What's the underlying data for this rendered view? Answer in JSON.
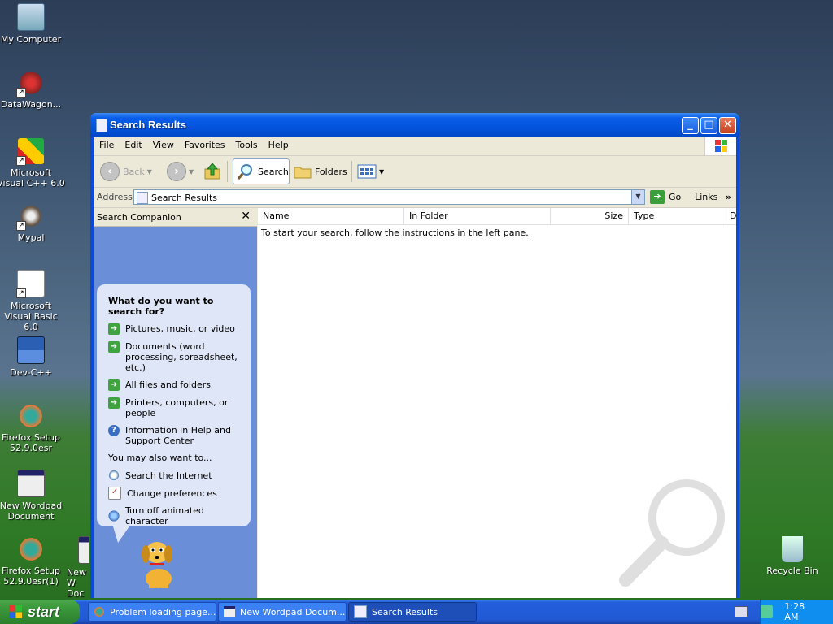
{
  "desktop": {
    "icons": [
      {
        "label": "My Computer",
        "icon": "computer-icon"
      },
      {
        "label": "DataWagon...",
        "icon": "datawagon-icon"
      },
      {
        "label": "Microsoft Visual C++ 6.0",
        "icon": "visual-cpp-icon"
      },
      {
        "label": "Mypal",
        "icon": "mypal-icon"
      },
      {
        "label": "Microsoft Visual Basic 6.0",
        "icon": "visual-basic-icon"
      },
      {
        "label": "Dev-C++",
        "icon": "dev-cpp-icon"
      },
      {
        "label": "Firefox Setup 52.9.0esr",
        "icon": "firefox-icon"
      },
      {
        "label": "New Wordpad Document",
        "icon": "wordpad-icon"
      },
      {
        "label": "Firefox Setup 52.9.0esr(1)",
        "icon": "firefox-icon"
      },
      {
        "label": "New W Doc",
        "icon": "wordpad-icon"
      },
      {
        "label": "Recycle Bin",
        "icon": "recycle-bin-icon"
      }
    ]
  },
  "window": {
    "title": "Search Results",
    "menu": [
      "File",
      "Edit",
      "View",
      "Favorites",
      "Tools",
      "Help"
    ],
    "toolbar": {
      "back": "Back",
      "search": "Search",
      "folders": "Folders"
    },
    "address": {
      "label": "Address",
      "value": "Search Results",
      "go": "Go",
      "links": "Links"
    },
    "companion": {
      "title": "Search Companion",
      "close": "✕",
      "heading": "What do you want to search for?",
      "options": [
        "Pictures, music, or video",
        "Documents (word processing, spreadsheet, etc.)",
        "All files and folders",
        "Printers, computers, or people"
      ],
      "help_option": "Information in Help and Support Center",
      "also_label": "You may also want to...",
      "also_options": [
        "Search the Internet",
        "Change preferences",
        "Turn off animated character"
      ]
    },
    "columns": [
      "Name",
      "In Folder",
      "Size",
      "Type",
      "D"
    ],
    "message": "To start your search, follow the instructions in the left pane."
  },
  "taskbar": {
    "start": "start",
    "tasks": [
      {
        "label": "Problem loading page...",
        "active": false
      },
      {
        "label": "New Wordpad Docum...",
        "active": false
      },
      {
        "label": "Search Results",
        "active": true
      }
    ],
    "clock": "1:28 AM"
  },
  "colors": {
    "titlebar": "#0353dc",
    "companion_pane": "#6b8ed9",
    "bubble": "#dfe6f7",
    "start_green": "#3c9a3c"
  }
}
